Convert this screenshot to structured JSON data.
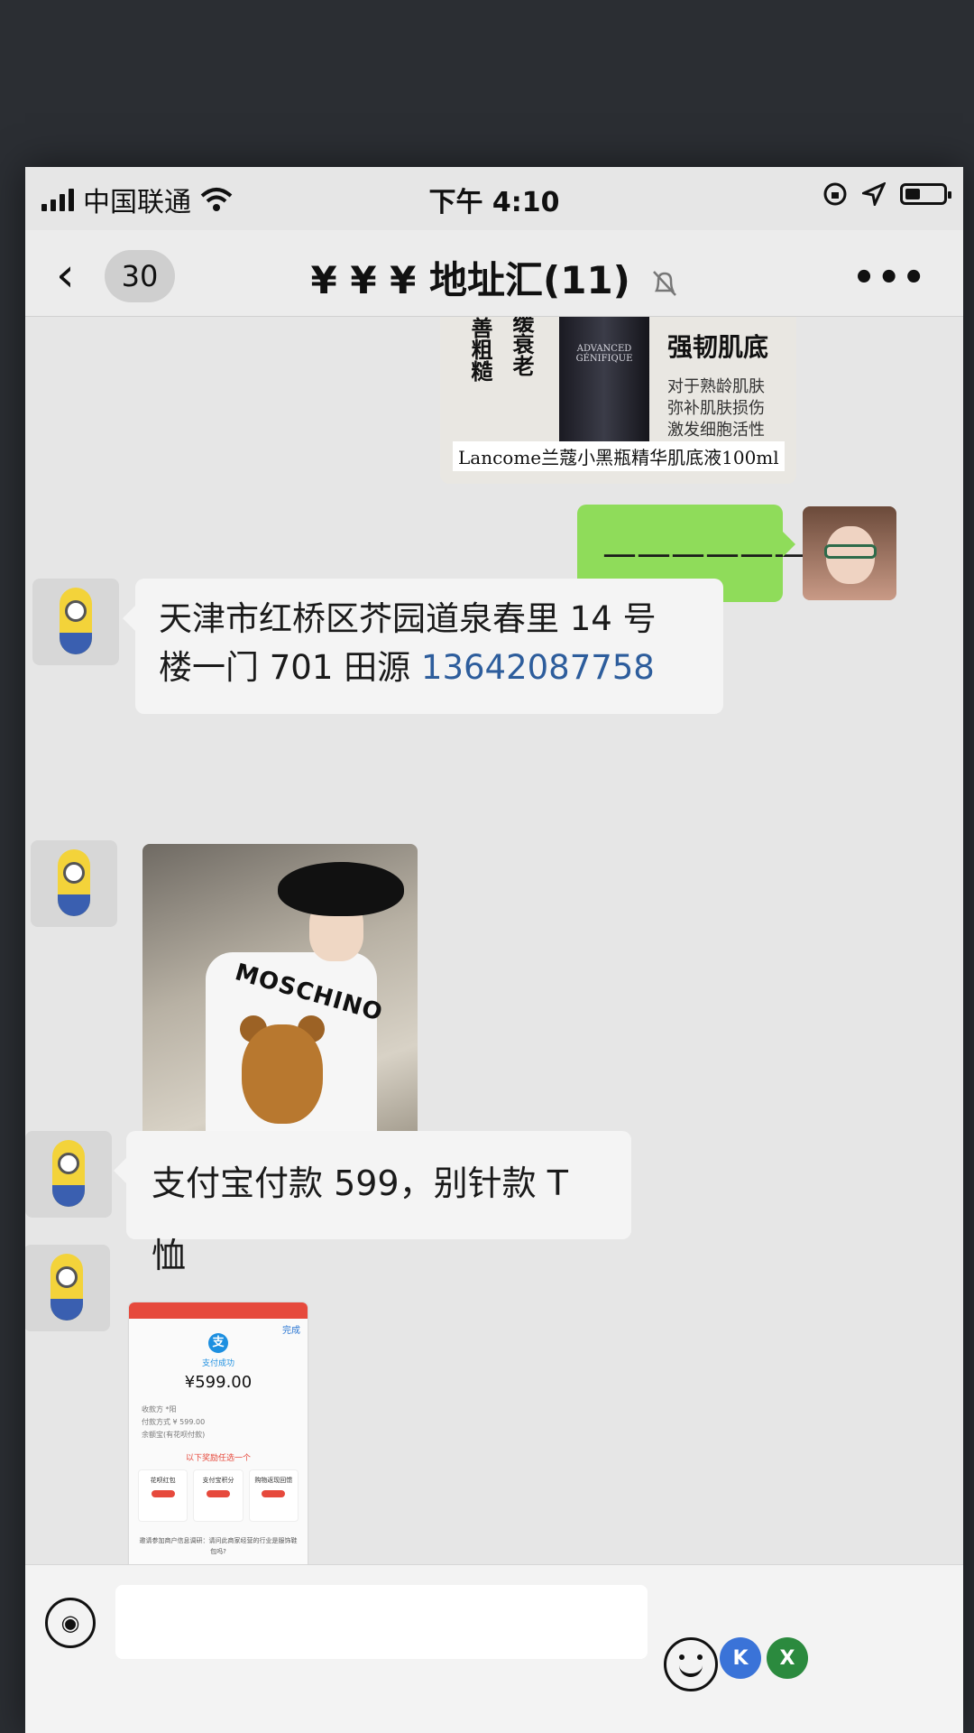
{
  "status_bar": {
    "carrier": "中国联通",
    "time": "下午 4:10"
  },
  "nav": {
    "unread_count": "30",
    "title": "¥ ¥ ¥ 地址汇(11)"
  },
  "messages": [
    {
      "type": "image",
      "from": "me",
      "product": {
        "left_text": "延缓衰老",
        "left_text2": "善粗糙",
        "headline": "强韧肌底",
        "desc": [
          "对于熟龄肌肤",
          "弥补肌肤损伤",
          "激发细胞活性"
        ],
        "caption": "Lancome兰蔻小黑瓶精华肌底液100ml",
        "bottle_label": "ADVANCED GÉNIFIQUE"
      }
    },
    {
      "type": "text",
      "from": "me",
      "text": "——————"
    },
    {
      "type": "text",
      "from": "other",
      "text_line1": "天津市红桥区芥园道泉春里 14 号",
      "text_line2": "楼一门 701 田源 ",
      "phone": "13642087758"
    },
    {
      "type": "image",
      "from": "other",
      "shirt_text": "MOSCHINO"
    },
    {
      "type": "text",
      "from": "other",
      "text": "支付宝付款 599，别针款 T 恤"
    },
    {
      "type": "image",
      "from": "other",
      "receipt": {
        "done": "完成",
        "success": "支付成功",
        "amount": "¥599.00",
        "rows": [
          "收款方    *阳",
          "付款方式    ¥ 599.00",
          "              余额宝(有花呗付款)"
        ],
        "banner": "以下奖励任选一个",
        "cards": [
          "花呗红包",
          "支付宝积分",
          "购物返现回馈"
        ],
        "footer": "邀请参加商户信息调研：请问此商家经营的行业是服饰鞋包吗?"
      }
    }
  ],
  "input": {
    "overlay_a": "K",
    "overlay_b": "X"
  },
  "icons": {
    "back": "chevron-left-icon",
    "mute": "bell-off-icon",
    "more": "more-icon",
    "voice": "voice-icon",
    "emoji": "emoji-icon"
  }
}
